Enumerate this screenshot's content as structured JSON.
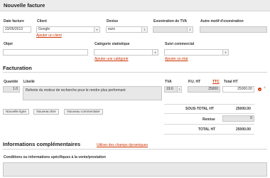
{
  "header": {
    "title": "Nouvelle facture"
  },
  "fields": {
    "date_label": "Date facture",
    "date_value": "23/05/2013",
    "client_label": "Client",
    "client_value": "Google",
    "client_link": "Ajouter un client",
    "devise_label": "Devise",
    "devise_value": "euro",
    "exo_label": "Exonération de TVA",
    "exo_value": "",
    "motif_label": "Autre motif d'exonération",
    "motif_value": "",
    "objet_label": "Objet",
    "objet_value": "",
    "categorie_label": "Catégorie statistique",
    "categorie_value": "",
    "categorie_link": "Ajouter une catégorie",
    "suivi_label": "Suivi commercial",
    "suivi_value": "",
    "suivi_link": "Ajouter un état"
  },
  "facturation": {
    "title": "Facturation",
    "col_quantite": "Quantité",
    "col_libelle": "Libellé",
    "col_tva": "TVA",
    "col_pu": "P.U. HT",
    "col_ttc": "TTC",
    "col_total": "Total HT",
    "line": {
      "quantite": "1.0",
      "libelle": "Refonte du moteur de recherche pour le rendre plus performant",
      "tva": "19.6",
      "pu": "25000",
      "total": "25000.00"
    },
    "buttons": {
      "nouvelle_ligne": "Nouvelle ligne",
      "nouveau_titre": "Nouveau titre",
      "nouveau_commentaire": "Nouveau commentaire"
    },
    "totals": {
      "sous_total_label": "SOUS-TOTAL HT",
      "sous_total_value": "25000.00",
      "remise_label": "Remise",
      "remise_value": "0",
      "total_label": "TOTAL HT",
      "total_value": "25000.00"
    }
  },
  "infos": {
    "title": "Informations complémentaires",
    "link": "Utiliser des champs dynamiques",
    "conditions_label": "Conditions ou informations spécifiques à la vente/prestation"
  }
}
